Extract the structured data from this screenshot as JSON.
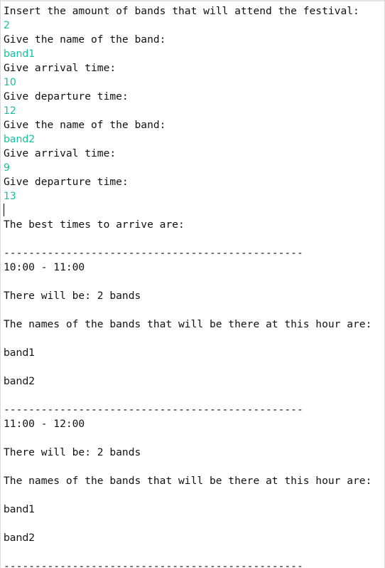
{
  "colors": {
    "input_text": "#1abc9c",
    "output_text": "#111111"
  },
  "console": {
    "lines": [
      "Insert the amount of bands that will attend the festival:",
      "2",
      "Give the name of the band:",
      "band1",
      "Give arrival time:",
      "10",
      "Give departure time:",
      "12",
      "Give the name of the band:",
      "band2",
      "Give arrival time:",
      "9",
      "Give departure time:",
      "13",
      "The best times to arrive are:",
      "------------------------------------------------",
      "10:00 - 11:00",
      "There will be: 2 bands",
      "The names of the bands that will be there at this hour are:",
      "band1",
      "band2",
      "------------------------------------------------",
      "11:00 - 12:00",
      "There will be: 2 bands",
      "The names of the bands that will be there at this hour are:",
      "band1",
      "band2",
      "------------------------------------------------"
    ]
  }
}
